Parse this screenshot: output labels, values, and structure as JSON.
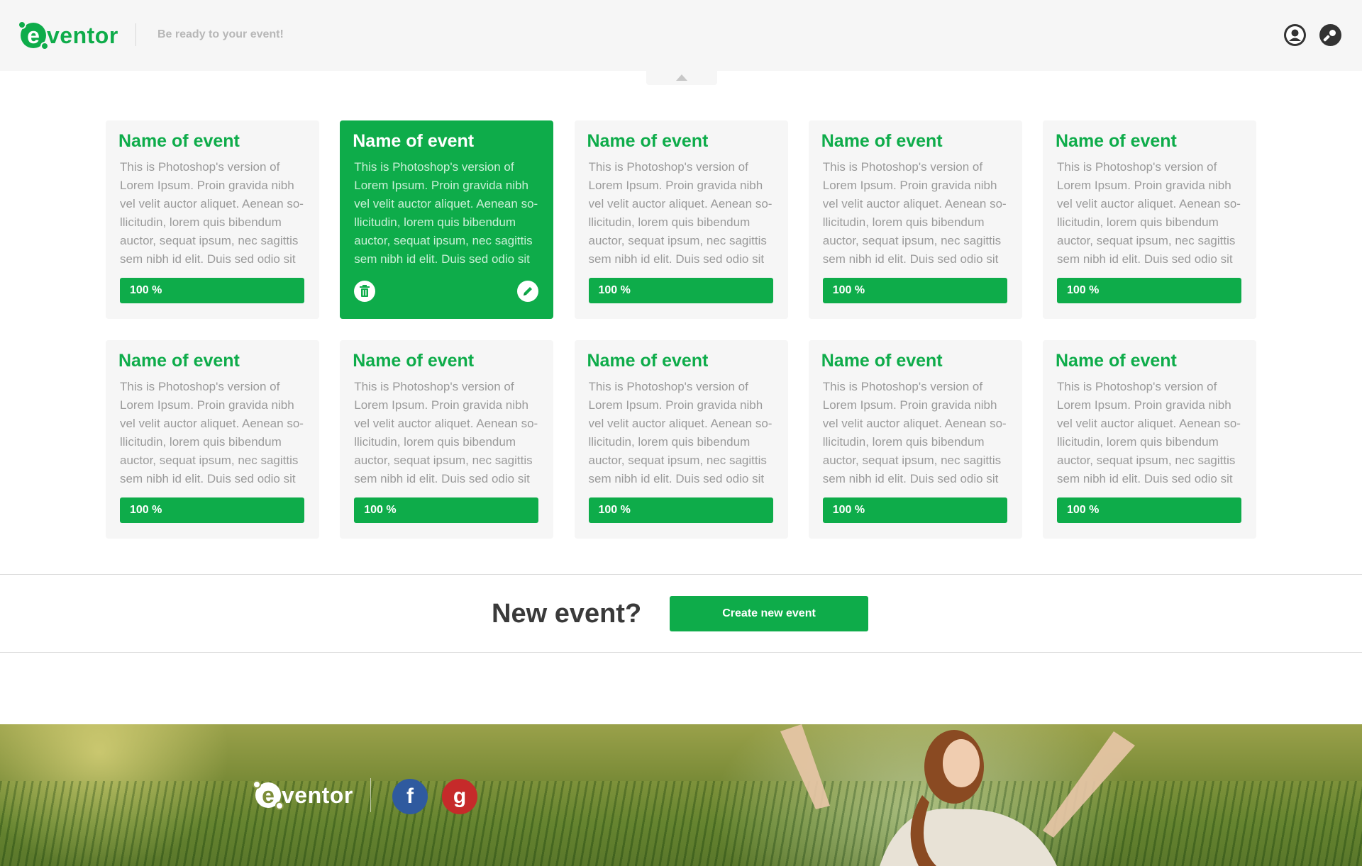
{
  "header": {
    "logo_first_letter": "e",
    "logo_rest": "ventor",
    "tagline": "Be ready to your event!",
    "icons": [
      "user-icon",
      "wrench-icon"
    ]
  },
  "events": [
    {
      "title": "Name of event",
      "description": "This is Photoshop's version  of Lorem Ipsum. Proin gravida nibh vel velit auctor aliquet. Aenean so-llicitudin, lorem quis bibendum auctor, sequat ipsum, nec sagittis sem nibh id elit. Duis sed odio sit",
      "progress": "100 %",
      "selected": false
    },
    {
      "title": "Name of event",
      "description": "This is Photoshop's version  of Lorem Ipsum. Proin gravida nibh vel velit auctor aliquet. Aenean so-llicitudin, lorem quis bibendum auctor, sequat ipsum, nec sagittis sem nibh id elit. Duis sed odio sit",
      "progress": "",
      "selected": true
    },
    {
      "title": "Name of event",
      "description": "This is Photoshop's version  of Lorem Ipsum. Proin gravida nibh vel velit auctor aliquet. Aenean so-llicitudin, lorem quis bibendum auctor, sequat ipsum, nec sagittis sem nibh id elit. Duis sed odio sit",
      "progress": "100 %",
      "selected": false
    },
    {
      "title": "Name of event",
      "description": "This is Photoshop's version  of Lorem Ipsum. Proin gravida nibh vel velit auctor aliquet. Aenean so-llicitudin, lorem quis bibendum auctor, sequat ipsum, nec sagittis sem nibh id elit. Duis sed odio sit",
      "progress": "100 %",
      "selected": false
    },
    {
      "title": "Name of event",
      "description": "This is Photoshop's version  of Lorem Ipsum. Proin gravida nibh vel velit auctor aliquet. Aenean so-llicitudin, lorem quis bibendum auctor, sequat ipsum, nec sagittis sem nibh id elit. Duis sed odio sit",
      "progress": "100 %",
      "selected": false
    },
    {
      "title": "Name of event",
      "description": "This is Photoshop's version  of Lorem Ipsum. Proin gravida nibh vel velit auctor aliquet. Aenean so-llicitudin, lorem quis bibendum auctor, sequat ipsum, nec sagittis sem nibh id elit. Duis sed odio sit",
      "progress": "100 %",
      "selected": false
    },
    {
      "title": "Name of event",
      "description": "This is Photoshop's version  of Lorem Ipsum. Proin gravida nibh vel velit auctor aliquet. Aenean so-llicitudin, lorem quis bibendum auctor, sequat ipsum, nec sagittis sem nibh id elit. Duis sed odio sit",
      "progress": "100 %",
      "selected": false
    },
    {
      "title": "Name of event",
      "description": "This is Photoshop's version  of Lorem Ipsum. Proin gravida nibh vel velit auctor aliquet. Aenean so-llicitudin, lorem quis bibendum auctor, sequat ipsum, nec sagittis sem nibh id elit. Duis sed odio sit",
      "progress": "100 %",
      "selected": false
    },
    {
      "title": "Name of event",
      "description": "This is Photoshop's version  of Lorem Ipsum. Proin gravida nibh vel velit auctor aliquet. Aenean so-llicitudin, lorem quis bibendum auctor, sequat ipsum, nec sagittis sem nibh id elit. Duis sed odio sit",
      "progress": "100 %",
      "selected": false
    },
    {
      "title": "Name of event",
      "description": "This is Photoshop's version  of Lorem Ipsum. Proin gravida nibh vel velit auctor aliquet. Aenean so-llicitudin, lorem quis bibendum auctor, sequat ipsum, nec sagittis sem nibh id elit. Duis sed odio sit",
      "progress": "100 %",
      "selected": false
    }
  ],
  "cta": {
    "title": "New event?",
    "button_label": "Create new event"
  },
  "footer": {
    "logo_first_letter": "e",
    "logo_rest": "ventor",
    "social": [
      {
        "name": "facebook-icon",
        "glyph": "f"
      },
      {
        "name": "google-icon",
        "glyph": "g"
      }
    ]
  },
  "colors": {
    "accent": "#0eac4a",
    "card_bg": "#f6f6f6",
    "header_bg": "#f6f6f6",
    "facebook": "#2f5a9f",
    "google": "#c62a2a"
  }
}
